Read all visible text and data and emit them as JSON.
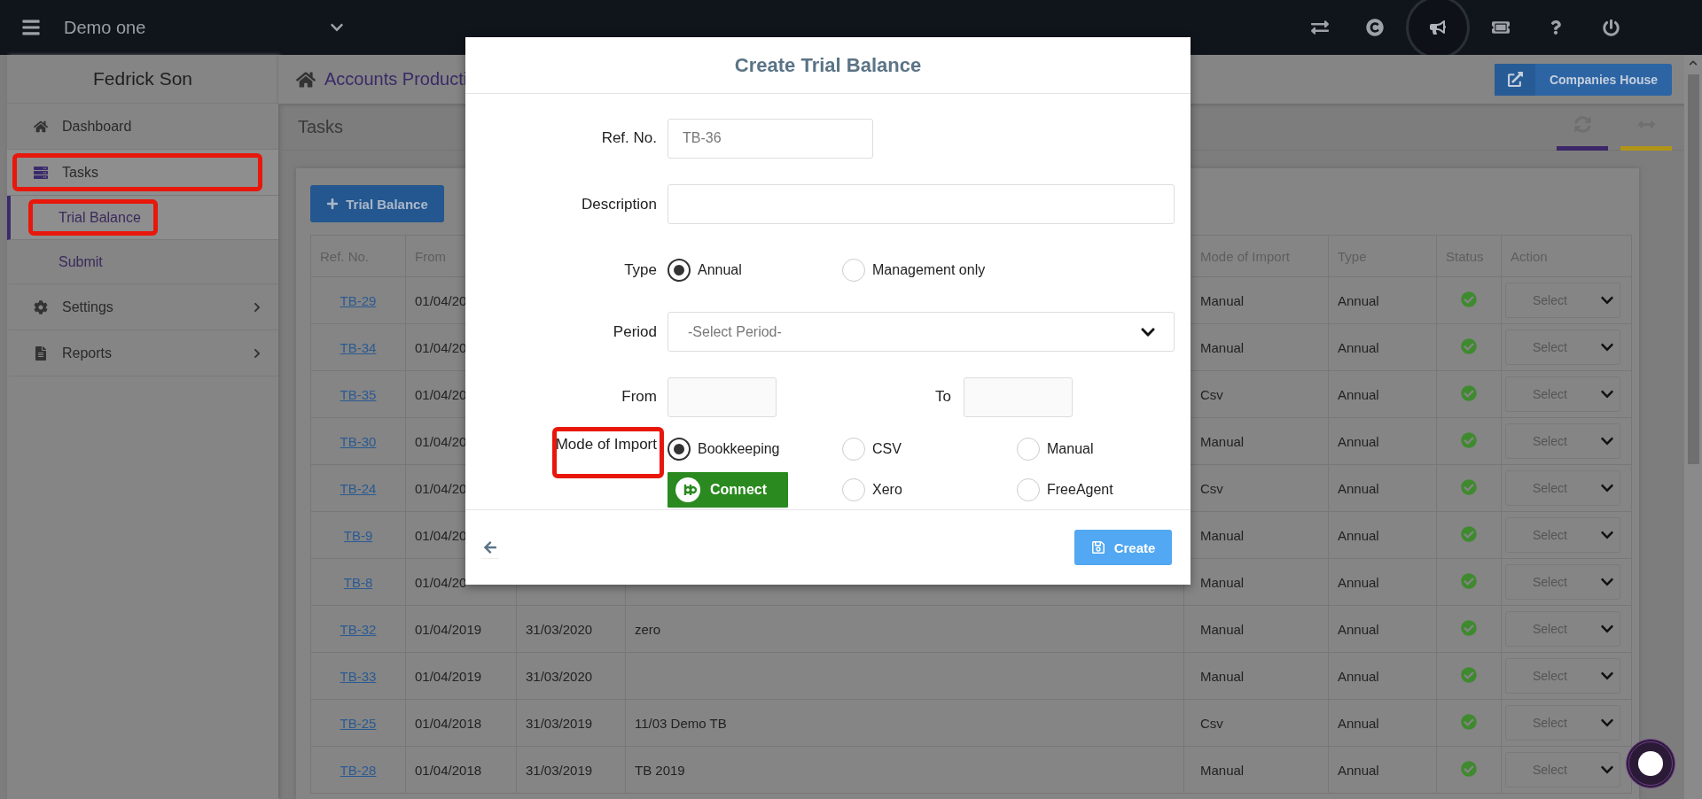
{
  "topbar": {
    "company": "Demo one"
  },
  "sidebar": {
    "user": "Fedrick Son",
    "items": [
      {
        "label": "Dashboard",
        "selected": false,
        "highlighted": false,
        "has_submenu": false
      },
      {
        "label": "Tasks",
        "selected": true,
        "highlighted": true,
        "has_submenu": false,
        "expanded": true,
        "children": [
          {
            "label": "Trial Balance",
            "selected": true,
            "highlighted": true
          },
          {
            "label": "Submit",
            "selected": false,
            "highlighted": false
          }
        ]
      },
      {
        "label": "Settings",
        "selected": false,
        "highlighted": false,
        "has_submenu": true
      },
      {
        "label": "Reports",
        "selected": false,
        "highlighted": false,
        "has_submenu": true
      }
    ]
  },
  "breadcrumb": "Accounts Producti",
  "companies_house_button": "Companies House",
  "page_title": "Tasks",
  "add_button": "Trial Balance",
  "table": {
    "columns": [
      "Ref. No.",
      "From",
      null,
      null,
      "Mode of Import",
      "Type",
      "Status",
      "Action"
    ],
    "rows": [
      {
        "ref": "TB-29",
        "from": "01/04/20",
        "mode": "Manual",
        "type": "Annual",
        "completed": true,
        "action": "Select"
      },
      {
        "ref": "TB-34",
        "from": "01/04/20",
        "mode": "Manual",
        "type": "Annual",
        "completed": true,
        "action": "Select"
      },
      {
        "ref": "TB-35",
        "from": "01/04/20",
        "mode": "Csv",
        "type": "Annual",
        "completed": true,
        "action": "Select"
      },
      {
        "ref": "TB-30",
        "from": "01/04/20",
        "mode": "Manual",
        "type": "Annual",
        "completed": true,
        "action": "Select"
      },
      {
        "ref": "TB-24",
        "from": "01/04/20",
        "mode": "Csv",
        "type": "Annual",
        "completed": true,
        "action": "Select"
      },
      {
        "ref": "TB-9",
        "from": "01/04/20",
        "mode": "Manual",
        "type": "Annual",
        "completed": true,
        "action": "Select"
      },
      {
        "ref": "TB-8",
        "from": "01/04/20",
        "mode": "Manual",
        "type": "Annual",
        "completed": true,
        "action": "Select"
      },
      {
        "ref": "TB-32",
        "from": "01/04/2019",
        "to": "31/03/2020",
        "description": "zero",
        "mode": "Manual",
        "type": "Annual",
        "completed": true,
        "action": "Select"
      },
      {
        "ref": "TB-33",
        "from": "01/04/2019",
        "to": "31/03/2020",
        "mode": "Manual",
        "type": "Annual",
        "completed": true,
        "action": "Select"
      },
      {
        "ref": "TB-25",
        "from": "01/04/2018",
        "to": "31/03/2019",
        "description": "11/03 Demo TB",
        "mode": "Csv",
        "type": "Annual",
        "completed": true,
        "action": "Select"
      },
      {
        "ref": "TB-28",
        "from": "01/04/2018",
        "to": "31/03/2019",
        "description": "TB 2019",
        "mode": "Manual",
        "type": "Annual",
        "completed": true,
        "action": "Select"
      }
    ]
  },
  "modal": {
    "title": "Create Trial Balance",
    "ref_label": "Ref. No.",
    "ref_value": "TB-36",
    "description_label": "Description",
    "type_label": "Type",
    "type_options": [
      {
        "label": "Annual",
        "selected": true
      },
      {
        "label": "Management only",
        "selected": false
      }
    ],
    "period_label": "Period",
    "period_placeholder": "-Select Period-",
    "from_label": "From",
    "to_label": "To",
    "mode_label": "Mode of Import",
    "mode_label_highlighted": true,
    "mode_options": [
      {
        "label": "Bookkeeping",
        "selected": true
      },
      {
        "label": "CSV",
        "selected": false
      },
      {
        "label": "Manual",
        "selected": false
      },
      {
        "label": "Xero",
        "selected": false
      },
      {
        "label": "FreeAgent",
        "selected": false
      }
    ],
    "connect_button": "Connect",
    "create_button": "Create"
  }
}
